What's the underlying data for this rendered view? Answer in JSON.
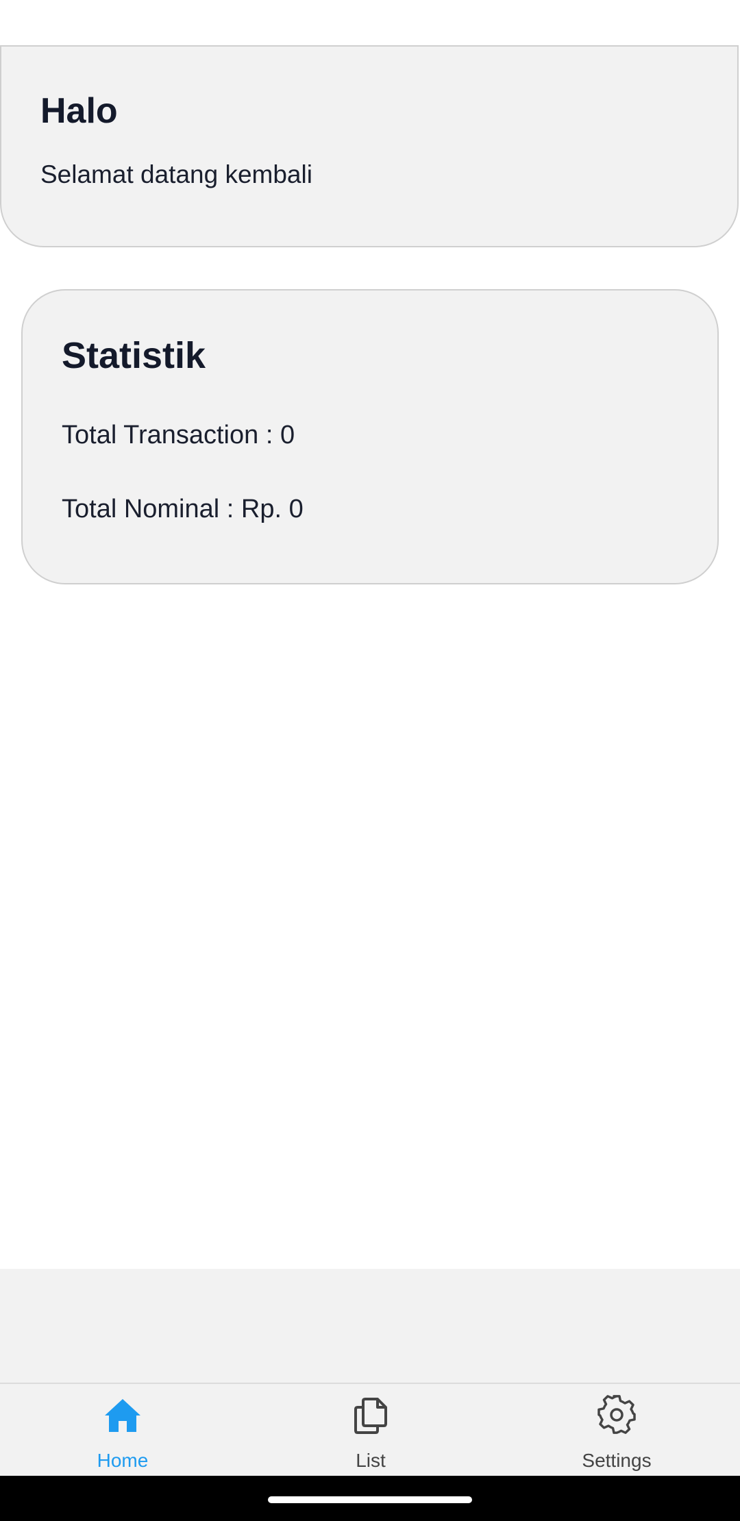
{
  "greeting": {
    "title": "Halo",
    "subtitle": "Selamat datang kembali"
  },
  "stats": {
    "title": "Statistik",
    "total_transaction_label": "Total Transaction",
    "total_transaction_value": "0",
    "total_nominal_label": "Total Nominal",
    "total_nominal_value": "Rp. 0"
  },
  "nav": {
    "items": [
      {
        "label": "Home",
        "icon": "home-icon",
        "active": true
      },
      {
        "label": "List",
        "icon": "documents-icon",
        "active": false
      },
      {
        "label": "Settings",
        "icon": "gear-icon",
        "active": false
      }
    ]
  },
  "colors": {
    "accent": "#1e9bf0",
    "card_background": "#f2f2f2",
    "text_primary": "#141a2b",
    "inactive_icon": "#444444"
  }
}
